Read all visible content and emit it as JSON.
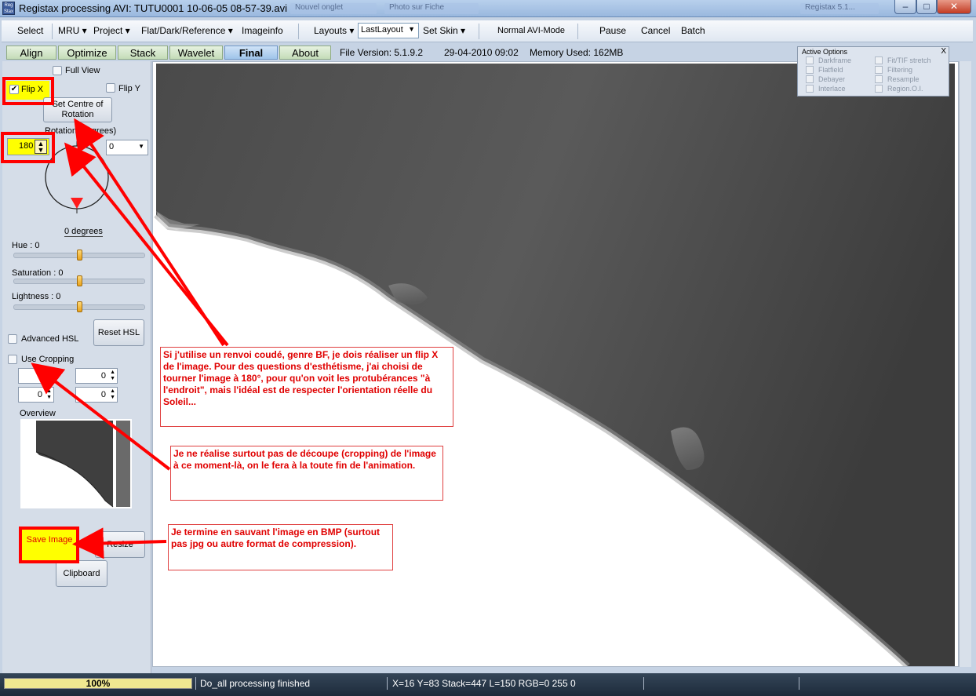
{
  "window": {
    "title": "Registax processing AVI: TUTU0001 10-06-05 08-57-39.avi",
    "icon": "registax-app-icon",
    "icon_text": "Reg Stax"
  },
  "background_tabs": [
    "Nouvel onglet",
    "Photo sur Fiche",
    "Registax 5.1..."
  ],
  "menu": {
    "select": "Select",
    "mru": "MRU ▾",
    "project": "Project ▾",
    "flat": "Flat/Dark/Reference ▾",
    "imageinfo": "Imageinfo",
    "layouts": "Layouts ▾",
    "layout_value": "LastLayout",
    "setskin": "Set Skin ▾",
    "normal_avi": "Normal AVI-Mode",
    "pause": "Pause",
    "cancel": "Cancel",
    "batch": "Batch"
  },
  "tabs": [
    "Align",
    "Optimize",
    "Stack",
    "Wavelet",
    "Final",
    "About"
  ],
  "active_tab": "Final",
  "fileinfo": {
    "version": "File Version: 5.1.9.2",
    "date": "29-04-2010 09:02",
    "memory": "Memory Used: 162MB"
  },
  "left": {
    "full_view": "Full View",
    "flip_x": "Flip X",
    "flip_y": "Flip Y",
    "set_centre": "Set Centre of Rotation",
    "rotation_label": "Rotation (degrees)",
    "rotation_value": "180",
    "rotation_dropdown": "0",
    "degrees_label": "0 degrees",
    "hue": "Hue : 0",
    "saturation": "Saturation : 0",
    "lightness": "Lightness : 0",
    "advanced_hsl": "Advanced HSL",
    "reset_hsl": "Reset HSL",
    "use_cropping": "Use Cropping",
    "crop_values": [
      "0",
      "0",
      "0",
      "0"
    ],
    "overview": "Overview",
    "save_image": "Save Image",
    "resize": "Resize",
    "clipboard": "Clipboard"
  },
  "active_options": {
    "title": "Active Options",
    "close": "X",
    "left": [
      "Darkframe",
      "Flatfield",
      "Debayer",
      "Interlace"
    ],
    "right": [
      "Fit/TIF stretch",
      "Filtering",
      "Resample",
      "Region.O.I."
    ]
  },
  "notes": {
    "flip": "Si j'utilise un renvoi coudé, genre BF, je dois réaliser un flip X de l'image. Pour des questions d'esthétisme, j'ai choisi de tourner l'image à 180°, pour qu'on voit les protubérances \"à l'endroit\", mais l'idéal est de respecter l'orientation réelle du Soleil...",
    "crop": "Je ne réalise surtout pas de découpe (cropping) de l'image à ce moment-là, on le fera à la toute fin de l'animation.",
    "save": "Je termine en sauvant l'image en BMP (surtout pas jpg ou autre format de compression)."
  },
  "status": {
    "progress": "100%",
    "message": "Do_all processing finished",
    "coords": "X=16 Y=83 Stack=447 L=150 RGB=0 255 0"
  },
  "colors": {
    "annotation": "#ff0000",
    "highlight": "#ffff00",
    "sun_disk": "#ffffff",
    "sky": "#3a3a3a"
  }
}
